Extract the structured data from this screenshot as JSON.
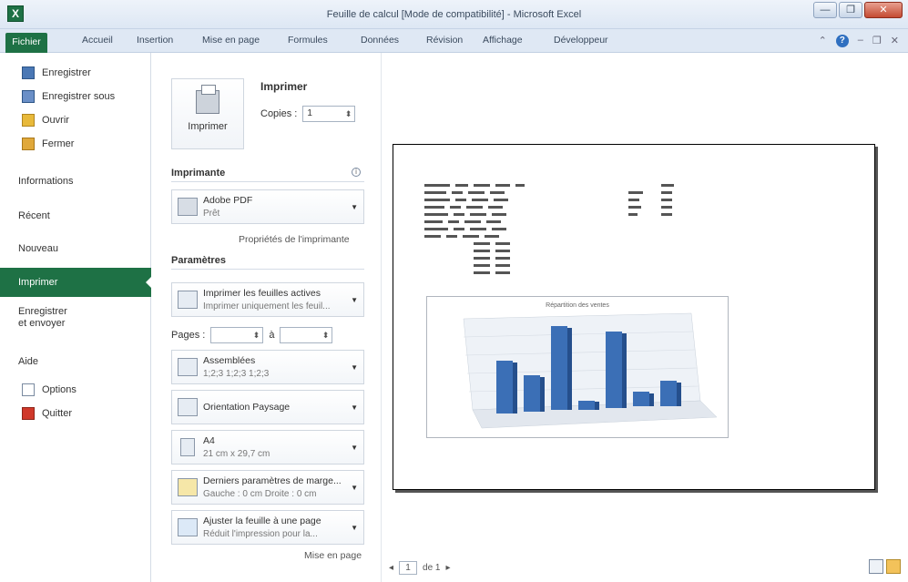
{
  "window": {
    "title": "Feuille de calcul [Mode de compatibilité] - Microsoft Excel",
    "app_icon_letter": "X",
    "controls": [
      "—",
      "❐",
      "✕"
    ]
  },
  "ribbon": {
    "file_tab": "Fichier",
    "tabs": [
      "Accueil",
      "Insertion",
      "Mise en page",
      "Formules",
      "Données",
      "Révision",
      "Affichage",
      "Développeur"
    ]
  },
  "nav": {
    "commands_top": [
      {
        "label": "Enregistrer",
        "icon": "save-icon"
      },
      {
        "label": "Enregistrer sous",
        "icon": "save-as-icon"
      },
      {
        "label": "Ouvrir",
        "icon": "open-folder-icon"
      },
      {
        "label": "Fermer",
        "icon": "close-folder-icon"
      }
    ],
    "sections": [
      "Informations",
      "Récent",
      "Nouveau"
    ],
    "active": "Imprimer",
    "save_send": [
      "Enregistrer",
      "et envoyer"
    ],
    "help": "Aide",
    "commands_bottom": [
      {
        "label": "Options",
        "icon": "options-icon"
      },
      {
        "label": "Quitter",
        "icon": "quit-icon"
      }
    ]
  },
  "print": {
    "title": "Imprimer",
    "button_label": "Imprimer",
    "copies_label": "Copies :",
    "copies_value": "1",
    "printer_section": "Imprimante",
    "printer_name": "Adobe PDF",
    "printer_status": "Prêt",
    "printer_properties": "Propriétés de l'imprimante",
    "settings_section": "Paramètres",
    "settings": [
      {
        "l1": "Imprimer les feuilles actives",
        "l2": "Imprimer uniquement les feuil...",
        "icon": "sheets-icon"
      },
      {
        "l1": "Assemblées",
        "l2": "1;2;3   1;2;3   1;2;3",
        "icon": "collate-icon"
      },
      {
        "l1": "Orientation Paysage",
        "l2": "",
        "icon": "landscape-icon"
      },
      {
        "l1": "A4",
        "l2": "21 cm x 29,7 cm",
        "icon": "paper-size-icon"
      },
      {
        "l1": "Derniers paramètres de marge...",
        "l2": "Gauche : 0 cm    Droite : 0 cm",
        "icon": "margins-icon"
      },
      {
        "l1": "Ajuster la feuille à une page",
        "l2": "Réduit l'impression pour la...",
        "icon": "scaling-icon"
      }
    ],
    "pages_label": "Pages :",
    "pages_to": "à",
    "page_setup_link": "Mise en page"
  },
  "preview": {
    "chart_title": "Répartition des ventes",
    "page_current": "1",
    "page_total": "de 1",
    "prev": "◂",
    "next": "▸"
  }
}
